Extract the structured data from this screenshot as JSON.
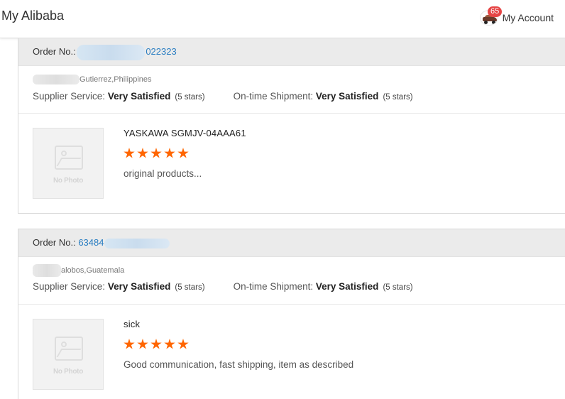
{
  "header": {
    "brand": "My Alibaba",
    "badge_count": "65",
    "account_label": "My Account"
  },
  "orders": [
    {
      "order_label": "Order No.:",
      "order_number_visible": "022323",
      "buyer": "Gutierrez,Philippines",
      "supplier_label": "Supplier Service:",
      "supplier_value": "Very Satisfied",
      "supplier_stars": "(5 stars)",
      "shipment_label": "On-time Shipment:",
      "shipment_value": "Very Satisfied",
      "shipment_stars": "(5 stars)",
      "photo_text": "No Photo",
      "product_title": "YASKAWA  SGMJV-04AAA61",
      "rating": 5,
      "comment": "original products..."
    },
    {
      "order_label": "Order No.:",
      "order_number_visible": "63484",
      "buyer": "alobos,Guatemala",
      "supplier_label": "Supplier Service:",
      "supplier_value": "Very Satisfied",
      "supplier_stars": "(5 stars)",
      "shipment_label": "On-time Shipment:",
      "shipment_value": "Very Satisfied",
      "shipment_stars": "(5 stars)",
      "photo_text": "No Photo",
      "product_title": "sick",
      "rating": 5,
      "comment": "Good communication, fast shipping, item as described"
    }
  ],
  "colors": {
    "accent_star": "#ff6600",
    "link": "#2a7ec2",
    "badge": "#e64545"
  }
}
